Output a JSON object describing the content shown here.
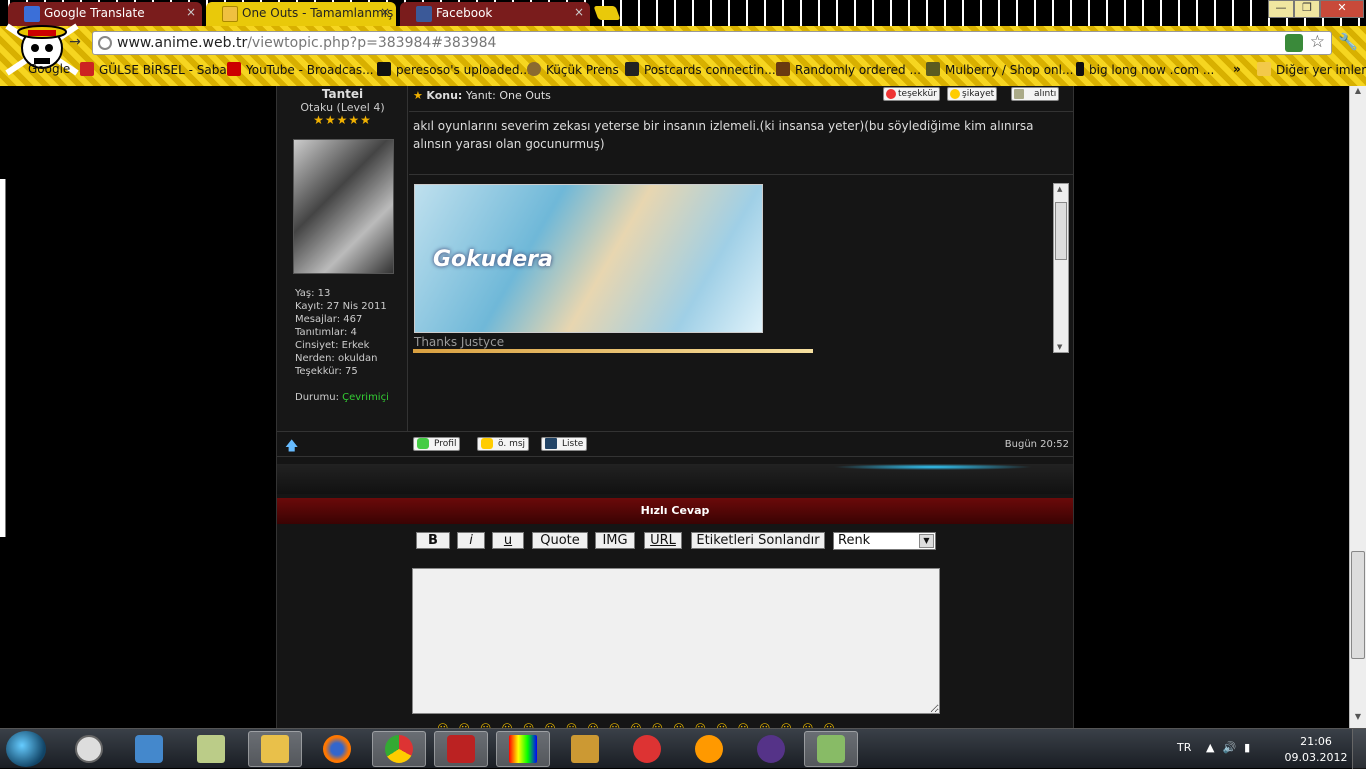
{
  "browser": {
    "tabs": [
      {
        "label": "Google Translate",
        "favicon_color": "#3b6fd8"
      },
      {
        "label": "One Outs - Tamamlanmış A",
        "favicon_color": "#f0c040"
      },
      {
        "label": "Facebook",
        "favicon_color": "#3b5998"
      }
    ],
    "tab_close": "×",
    "window_controls": {
      "minimize": "—",
      "maximize": "❐",
      "close": "✕"
    },
    "url_domain": "www.anime.web.tr",
    "url_path": "/viewtopic.php?p=383984#383984",
    "star_icon": "☆",
    "wrench_icon": "🔧",
    "bookmarks": [
      {
        "label": "Google",
        "color": "#4a8af4"
      },
      {
        "label": "GÜLSE BİRSEL - Sabah",
        "color": "#cc2222"
      },
      {
        "label": "YouTube - Broadcas...",
        "color": "#cc0000"
      },
      {
        "label": "peresoso's uploaded...",
        "color": "#111111"
      },
      {
        "label": "Küçük Prens",
        "color": "#8a6a30"
      },
      {
        "label": "Postcards connectin...",
        "color": "#222222"
      },
      {
        "label": "Randomly ordered ...",
        "color": "#6a3a10"
      },
      {
        "label": "Mulberry / Shop onl...",
        "color": "#5a5a20"
      },
      {
        "label": "big long now .com ...",
        "color": "#111111"
      }
    ],
    "bookmarks_more": "»",
    "other_bookmarks": "Diğer yer imleri"
  },
  "post": {
    "username": "Tantei",
    "rank": "Otaku (Level 4)",
    "stars": "★★★★★",
    "stats": [
      "Yaş: 13",
      "Kayıt: 27 Nis 2011",
      "Mesajlar: 467",
      "Tanıtımlar: 4",
      "Cinsiyet: Erkek",
      "Nerden: okuldan",
      "Teşekkür: 75"
    ],
    "status_label": "Durumu:",
    "status_value": "Çevrimiçi",
    "subject_label": "Konu:",
    "subject": "Yanıt: One Outs",
    "buttons": {
      "thanks": "teşekkür",
      "report": "şikayet",
      "quote": "alıntı"
    },
    "message": "akıl oyunlarını severim zekası yeterse bir insanın izlemeli.(ki insansa yeter)(bu söylediğime kim alınırsa alınsın yarası olan gocunurmuş)",
    "signature_banner_text": "Gokudera",
    "signature_caption": "Thanks Justyce",
    "footer_buttons": {
      "profile": "Profil",
      "pm": "ö. msj",
      "list": "Liste"
    },
    "time": "Bugün 20:52"
  },
  "quick_reply": {
    "title": "Hızlı Cevap",
    "buttons": [
      "B",
      "i",
      "u",
      "Quote",
      "IMG",
      "URL",
      "Etiketleri Sonlandır"
    ],
    "color_select": "Renk",
    "textarea_value": ""
  },
  "taskbar": {
    "apps": [
      "clock",
      "media",
      "folder-shortcut",
      "explorer",
      "firefox",
      "chrome",
      "flash",
      "filmstrip",
      "photos",
      "adobe-cs",
      "messenger",
      "torrent",
      "people"
    ],
    "lang": "TR",
    "time": "21:06",
    "date": "09.03.2012"
  }
}
